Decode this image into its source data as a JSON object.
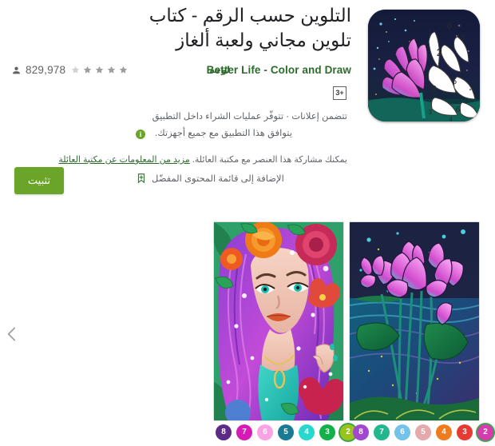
{
  "app": {
    "title": "التلوين حسب الرقم - كتاب تلوين مجاني ولعبة ألغاز",
    "developer": "Better Life - Color and Draw",
    "developer_extra": "لوحة",
    "install_count": "829,978",
    "rating_stars": 5,
    "content_rating": "3+",
    "install_button": "تثبيت",
    "accent_green": "#6aa52a",
    "link_green": "#2d6b2d"
  },
  "notes": {
    "monetization": "تتضمن إعلانات · تتوفّر عمليات الشراء داخل التطبيق",
    "compatibility": "يتوافق هذا التطبيق مع جميع أجهزتك.",
    "info_icon_glyph": "i"
  },
  "family": {
    "share_text": "يمكنك مشاركة هذا العنصر مع مكتبة العائلة.",
    "learn_more": "مزيد من المعلومات عن مكتبة العائلة",
    "wishlist_label": "الإضافة إلى قائمة المحتوى المفضّل"
  },
  "icons": {
    "person": "person-icon",
    "star": "star-icon",
    "info": "info-icon",
    "bookmark": "bookmark-add-icon",
    "prev": "chevron-left-icon"
  },
  "screenshots": [
    {
      "name": "screenshot-girl-flowers",
      "alt": "فتاة بشعر بنفسجي وزهور"
    },
    {
      "name": "screenshot-lotus-pond",
      "alt": "زهور لوتس على بركة ليلية"
    }
  ],
  "palettes": [
    {
      "name": "palette-screenshot-1",
      "swatches": [
        {
          "number": "2",
          "color": "#d63bb0",
          "selected": true
        },
        {
          "number": "3",
          "color": "#e63b32",
          "selected": false
        },
        {
          "number": "4",
          "color": "#f07b1e",
          "selected": false
        },
        {
          "number": "5",
          "color": "#e5a8ab",
          "selected": false
        },
        {
          "number": "6",
          "color": "#73c2ea",
          "selected": false
        },
        {
          "number": "7",
          "color": "#23b78e",
          "selected": false
        },
        {
          "number": "8",
          "color": "#a447cf",
          "selected": false
        }
      ]
    },
    {
      "name": "palette-screenshot-2",
      "swatches": [
        {
          "number": "2",
          "color": "#9ac31c",
          "selected": true
        },
        {
          "number": "3",
          "color": "#12b14a",
          "selected": false
        },
        {
          "number": "4",
          "color": "#27d8cf",
          "selected": false
        },
        {
          "number": "5",
          "color": "#1b7a93",
          "selected": false
        },
        {
          "number": "6",
          "color": "#f9a3e4",
          "selected": false
        },
        {
          "number": "7",
          "color": "#d61ab8",
          "selected": false
        },
        {
          "number": "8",
          "color": "#5b2b86",
          "selected": false
        }
      ]
    }
  ],
  "app_icon": {
    "numbers": [
      "1",
      "2",
      "3",
      "4",
      "5",
      "6",
      "7",
      "8"
    ],
    "bg_color": "#151a33",
    "petal_color": "#d94fd0"
  }
}
